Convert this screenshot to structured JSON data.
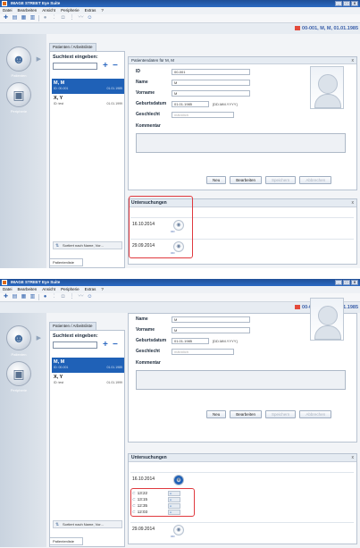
{
  "app": {
    "title": "IMAGE STREET Eye Suite",
    "menu": [
      "Datei",
      "Bearbeiten",
      "Ansicht",
      "Peripherie",
      "Extras",
      "?"
    ],
    "window_buttons": [
      "_",
      "□",
      "X"
    ]
  },
  "patient_bar": {
    "id_text": "00-001, M, M, 01.01.1985"
  },
  "tab": {
    "label": "Patienten / Arbeitsliste"
  },
  "nav": [
    {
      "label": "Patienten",
      "icon": "patient-icon"
    },
    {
      "label": "Peripherie",
      "icon": "device-icon"
    }
  ],
  "search": {
    "label": "Suchtext eingeben:",
    "value": ""
  },
  "patients": [
    {
      "name": "M, M",
      "id": "ID: 00-001",
      "dob": "01.01.1985",
      "selected": true
    },
    {
      "name": "X, Y",
      "id": "ID: test",
      "dob": "01.01.1999",
      "selected": false
    }
  ],
  "sort_label": "Sortiert nach Name, Vor...",
  "list_tab": "Patientenliste",
  "details": {
    "header": "Patientendaten für M, M",
    "fields": [
      {
        "label": "ID",
        "value": "00-001"
      },
      {
        "label": "Name",
        "value": "M"
      },
      {
        "label": "Vorname",
        "value": "M"
      },
      {
        "label": "Geburtsdatum",
        "value": "01.01.1985",
        "hint": "[DD.MM.YYYY]"
      },
      {
        "label": "Geschlecht",
        "value": "männlich"
      }
    ],
    "comment_label": "Kommentar",
    "buttons": [
      {
        "label": "Neu",
        "enabled": true
      },
      {
        "label": "Bearbeiten",
        "enabled": true
      },
      {
        "label": "Speichern",
        "enabled": false
      },
      {
        "label": "Abbrechen",
        "enabled": false
      }
    ]
  },
  "untersuchungen": {
    "title": "Untersuchungen",
    "exams": [
      {
        "date": "16.10.2014",
        "eye": "OD"
      },
      {
        "date": "29.09.2014",
        "eye": "OD"
      }
    ],
    "sub_times": [
      "13:22",
      "13:15",
      "12:35",
      "12:03"
    ]
  },
  "close_glyph": "x"
}
